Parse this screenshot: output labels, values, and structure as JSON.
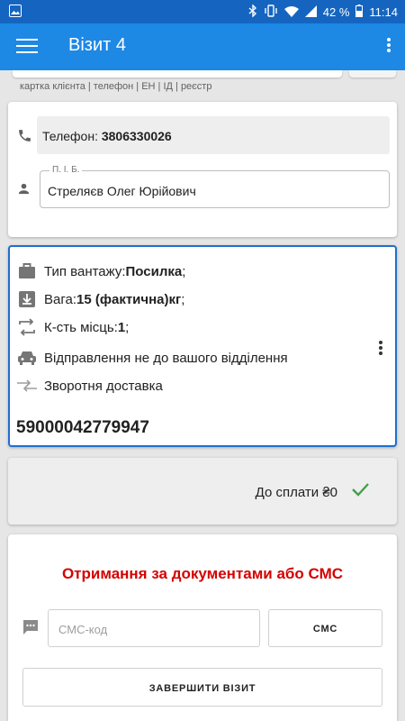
{
  "status_bar": {
    "battery": "42 %",
    "time": "11:14"
  },
  "app_bar": {
    "title": "Візит 4"
  },
  "search_hint": "картка клієнта | телефон | ЕН | ІД | реєстр",
  "client": {
    "phone_label": "Телефон: ",
    "phone_value": "3806330026",
    "fio_legend": "П. І. Б.",
    "fio_value": "Стреляєв Олег Юрійович"
  },
  "shipment": {
    "cargo_label": "Тип вантажу: ",
    "cargo_value": "Посилка",
    "cargo_suffix": ";",
    "weight_label": "Вага: ",
    "weight_value": "15 (фактична)кг",
    "weight_suffix": ";",
    "places_label": "К-сть місць: ",
    "places_value": "1",
    "places_suffix": ";",
    "dispatch_text": "Відправлення не до вашого відділення",
    "return_text": "Зворотня доставка",
    "ttn": "59000042779947"
  },
  "payment": {
    "text": "До сплати ₴0"
  },
  "receive": {
    "title": "Отримання за документами або СМС",
    "sms_placeholder": "СМС-код",
    "sms_button": "СМС",
    "finish_button": "ЗАВЕРШИТИ ВІЗИТ"
  },
  "colors": {
    "status_bar": "#1565c0",
    "app_bar": "#1e88e5",
    "accent_border": "#1e6fcf",
    "alert_red": "#d50000",
    "check_green": "#43a047"
  },
  "icons": [
    "image-icon",
    "bluetooth-icon",
    "vibrate-icon",
    "wifi-icon",
    "signal-icon",
    "battery-icon",
    "menu-icon",
    "more-vert-icon",
    "phone-icon",
    "person-icon",
    "briefcase-icon",
    "weight-icon",
    "swap-icon",
    "car-icon",
    "return-arrows-icon",
    "check-icon",
    "sms-icon"
  ]
}
